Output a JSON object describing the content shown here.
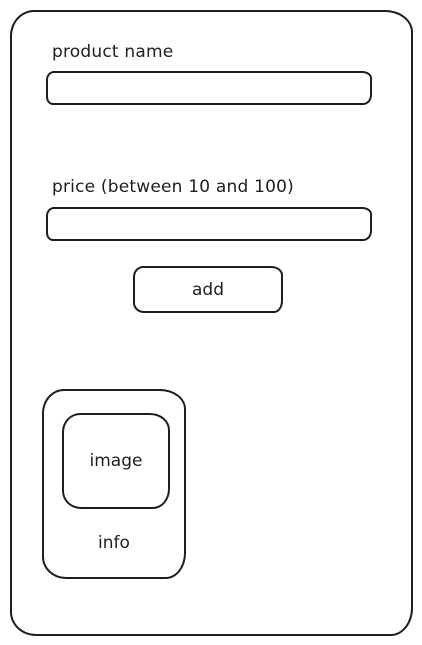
{
  "form": {
    "product_name_label": "product name",
    "product_name_value": "",
    "price_label": "price (between 10 and 100)",
    "price_value": "",
    "add_button_label": "add"
  },
  "product_card": {
    "image_label": "image",
    "info_label": "info"
  }
}
